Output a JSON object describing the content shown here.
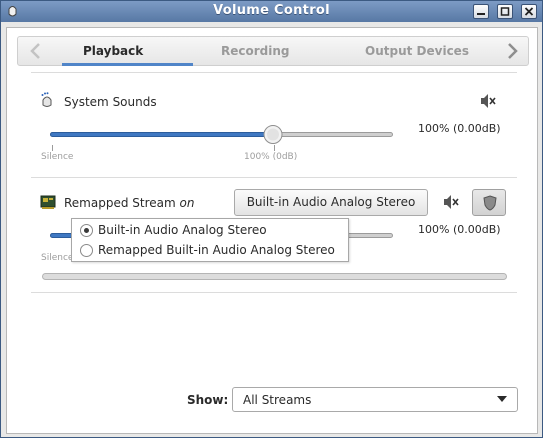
{
  "window": {
    "title": "Volume Control"
  },
  "tabs": [
    {
      "label": "Playback",
      "active": true
    },
    {
      "label": "Recording",
      "active": false
    },
    {
      "label": "Output Devices",
      "active": false
    }
  ],
  "streams": [
    {
      "name": "System Sounds",
      "volume_fraction": 0.75,
      "level": "100% (0.00dB)",
      "tick_silence": "Silence",
      "tick_100": "100% (0dB)"
    },
    {
      "name": "Remapped Stream",
      "status": "on",
      "device_button": "Built-in Audio Analog Stereo",
      "level": "100% (0.00dB)",
      "tick_silence": "Silence"
    }
  ],
  "device_popup": {
    "options": [
      {
        "label": "Built-in Audio Analog Stereo",
        "selected": true
      },
      {
        "label": "Remapped Built-in Audio Analog Stereo",
        "selected": false
      }
    ]
  },
  "footer": {
    "show_label": "Show:",
    "show_value": "All Streams"
  },
  "colors": {
    "titlebar": "#5f7fa6",
    "slider_fill": "#3f78c2",
    "active_tab_underline": "#5085c8"
  }
}
